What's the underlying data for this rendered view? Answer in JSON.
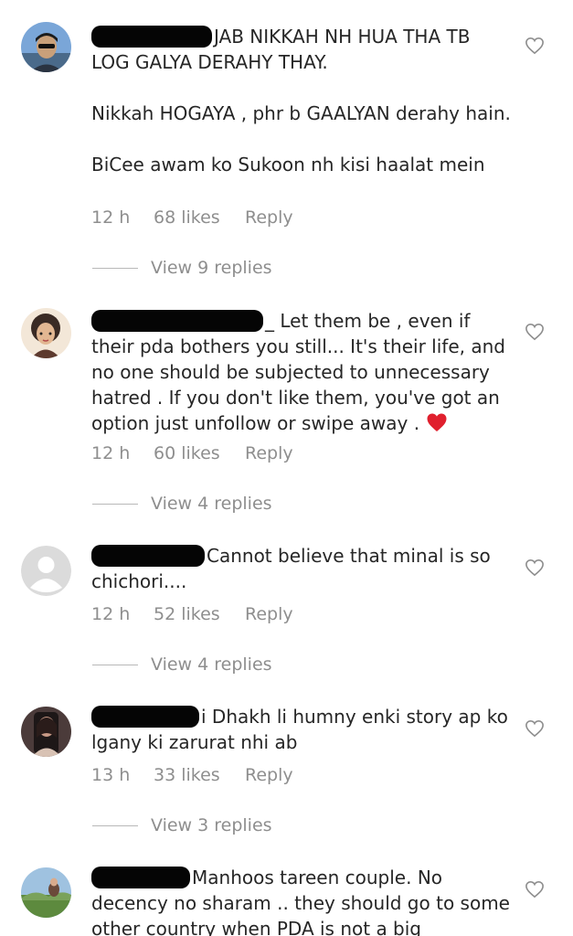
{
  "comments": [
    {
      "lines": [
        "JAB NIKKAH NH HUA THA TB LOG GALYA DERAHY THAY."
      ],
      "para2": "Nikkah HOGAYA , phr b GAALYAN derahy hain.",
      "para3": "BiCee awam ko Sukoon nh kisi haalat mein",
      "time": "12 h",
      "likes": "68 likes",
      "reply": "Reply",
      "view_replies": "View 9 replies"
    },
    {
      "text": "_ Let them be , even if their pda bothers you still... It's their life, and no one should be subjected to unnecessary hatred . If you don't like them, you've got an option just unfollow or swipe away .",
      "time": "12 h",
      "likes": "60 likes",
      "reply": "Reply",
      "view_replies": "View 4 replies"
    },
    {
      "text": "Cannot believe that minal is so chichori....",
      "time": "12 h",
      "likes": "52 likes",
      "reply": "Reply",
      "view_replies": "View 4 replies"
    },
    {
      "text": "i Dhakh li humny enki story ap ko lgany ki zarurat nhi ab",
      "time": "13 h",
      "likes": "33 likes",
      "reply": "Reply",
      "view_replies": "View 3 replies"
    },
    {
      "text": "Manhoos tareen couple. No decency no sharam .. they should go to some other country when PDA is not a big"
    }
  ],
  "icons": {
    "like": "heart-outline-icon",
    "emoji": "red-heart-emoji-icon"
  },
  "colors": {
    "text": "#262626",
    "meta": "#8e8e8e",
    "redaction": "#050505",
    "emoji_heart": "#e0202e"
  }
}
